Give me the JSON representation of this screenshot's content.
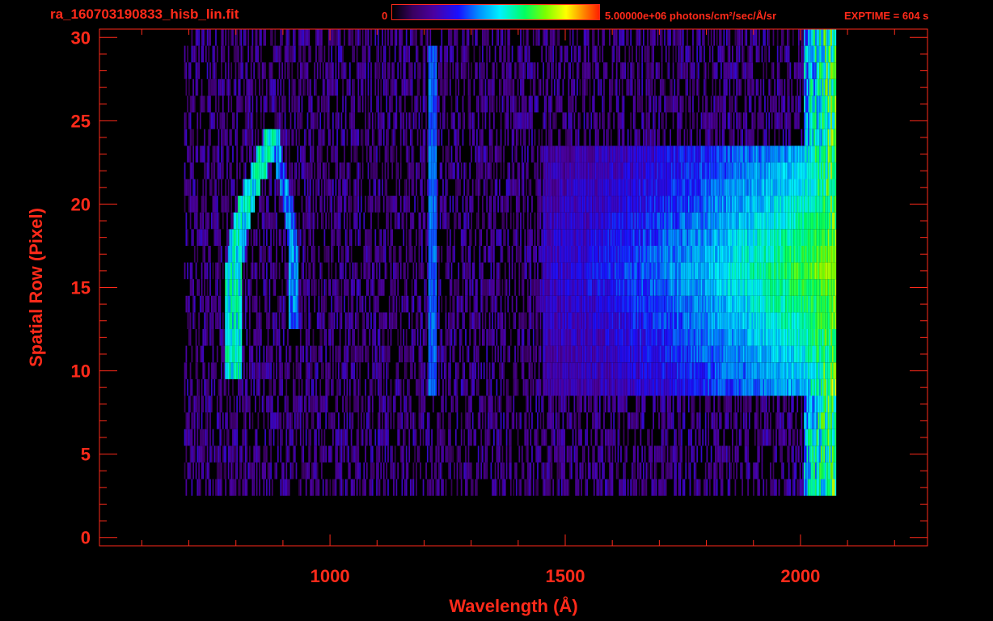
{
  "header": {
    "title": "ra_160703190833_hisb_lin.fit",
    "colorbar_min": "0",
    "colorbar_max": "5.00000e+06 photons/cm²/sec/Å/sr",
    "exptime": "EXPTIME = 604 s"
  },
  "colors": {
    "axis": "#ff2a1a",
    "background": "#000000"
  },
  "chart_data": {
    "type": "heatmap",
    "xlabel": "Wavelength (Å)",
    "ylabel": "Spatial Row (Pixel)",
    "xlim": [
      510,
      2270
    ],
    "ylim": [
      -0.5,
      30.5
    ],
    "x_ticks": [
      1000,
      1500,
      2000
    ],
    "y_ticks": [
      0,
      5,
      10,
      15,
      20,
      25,
      30
    ],
    "rows_with_signal": [
      3,
      30
    ],
    "spectrum_x_range": [
      690,
      2075
    ],
    "features": [
      {
        "name": "arc emission",
        "x_range": [
          790,
          960
        ],
        "rows": [
          10,
          24
        ]
      },
      {
        "name": "line emission",
        "x": 1216,
        "rows": [
          9,
          29
        ]
      },
      {
        "name": "continuum band",
        "x_range": [
          1450,
          2075
        ],
        "rows": [
          9,
          23
        ]
      }
    ],
    "colorbar": {
      "min": 0,
      "max": 5000000
    }
  }
}
